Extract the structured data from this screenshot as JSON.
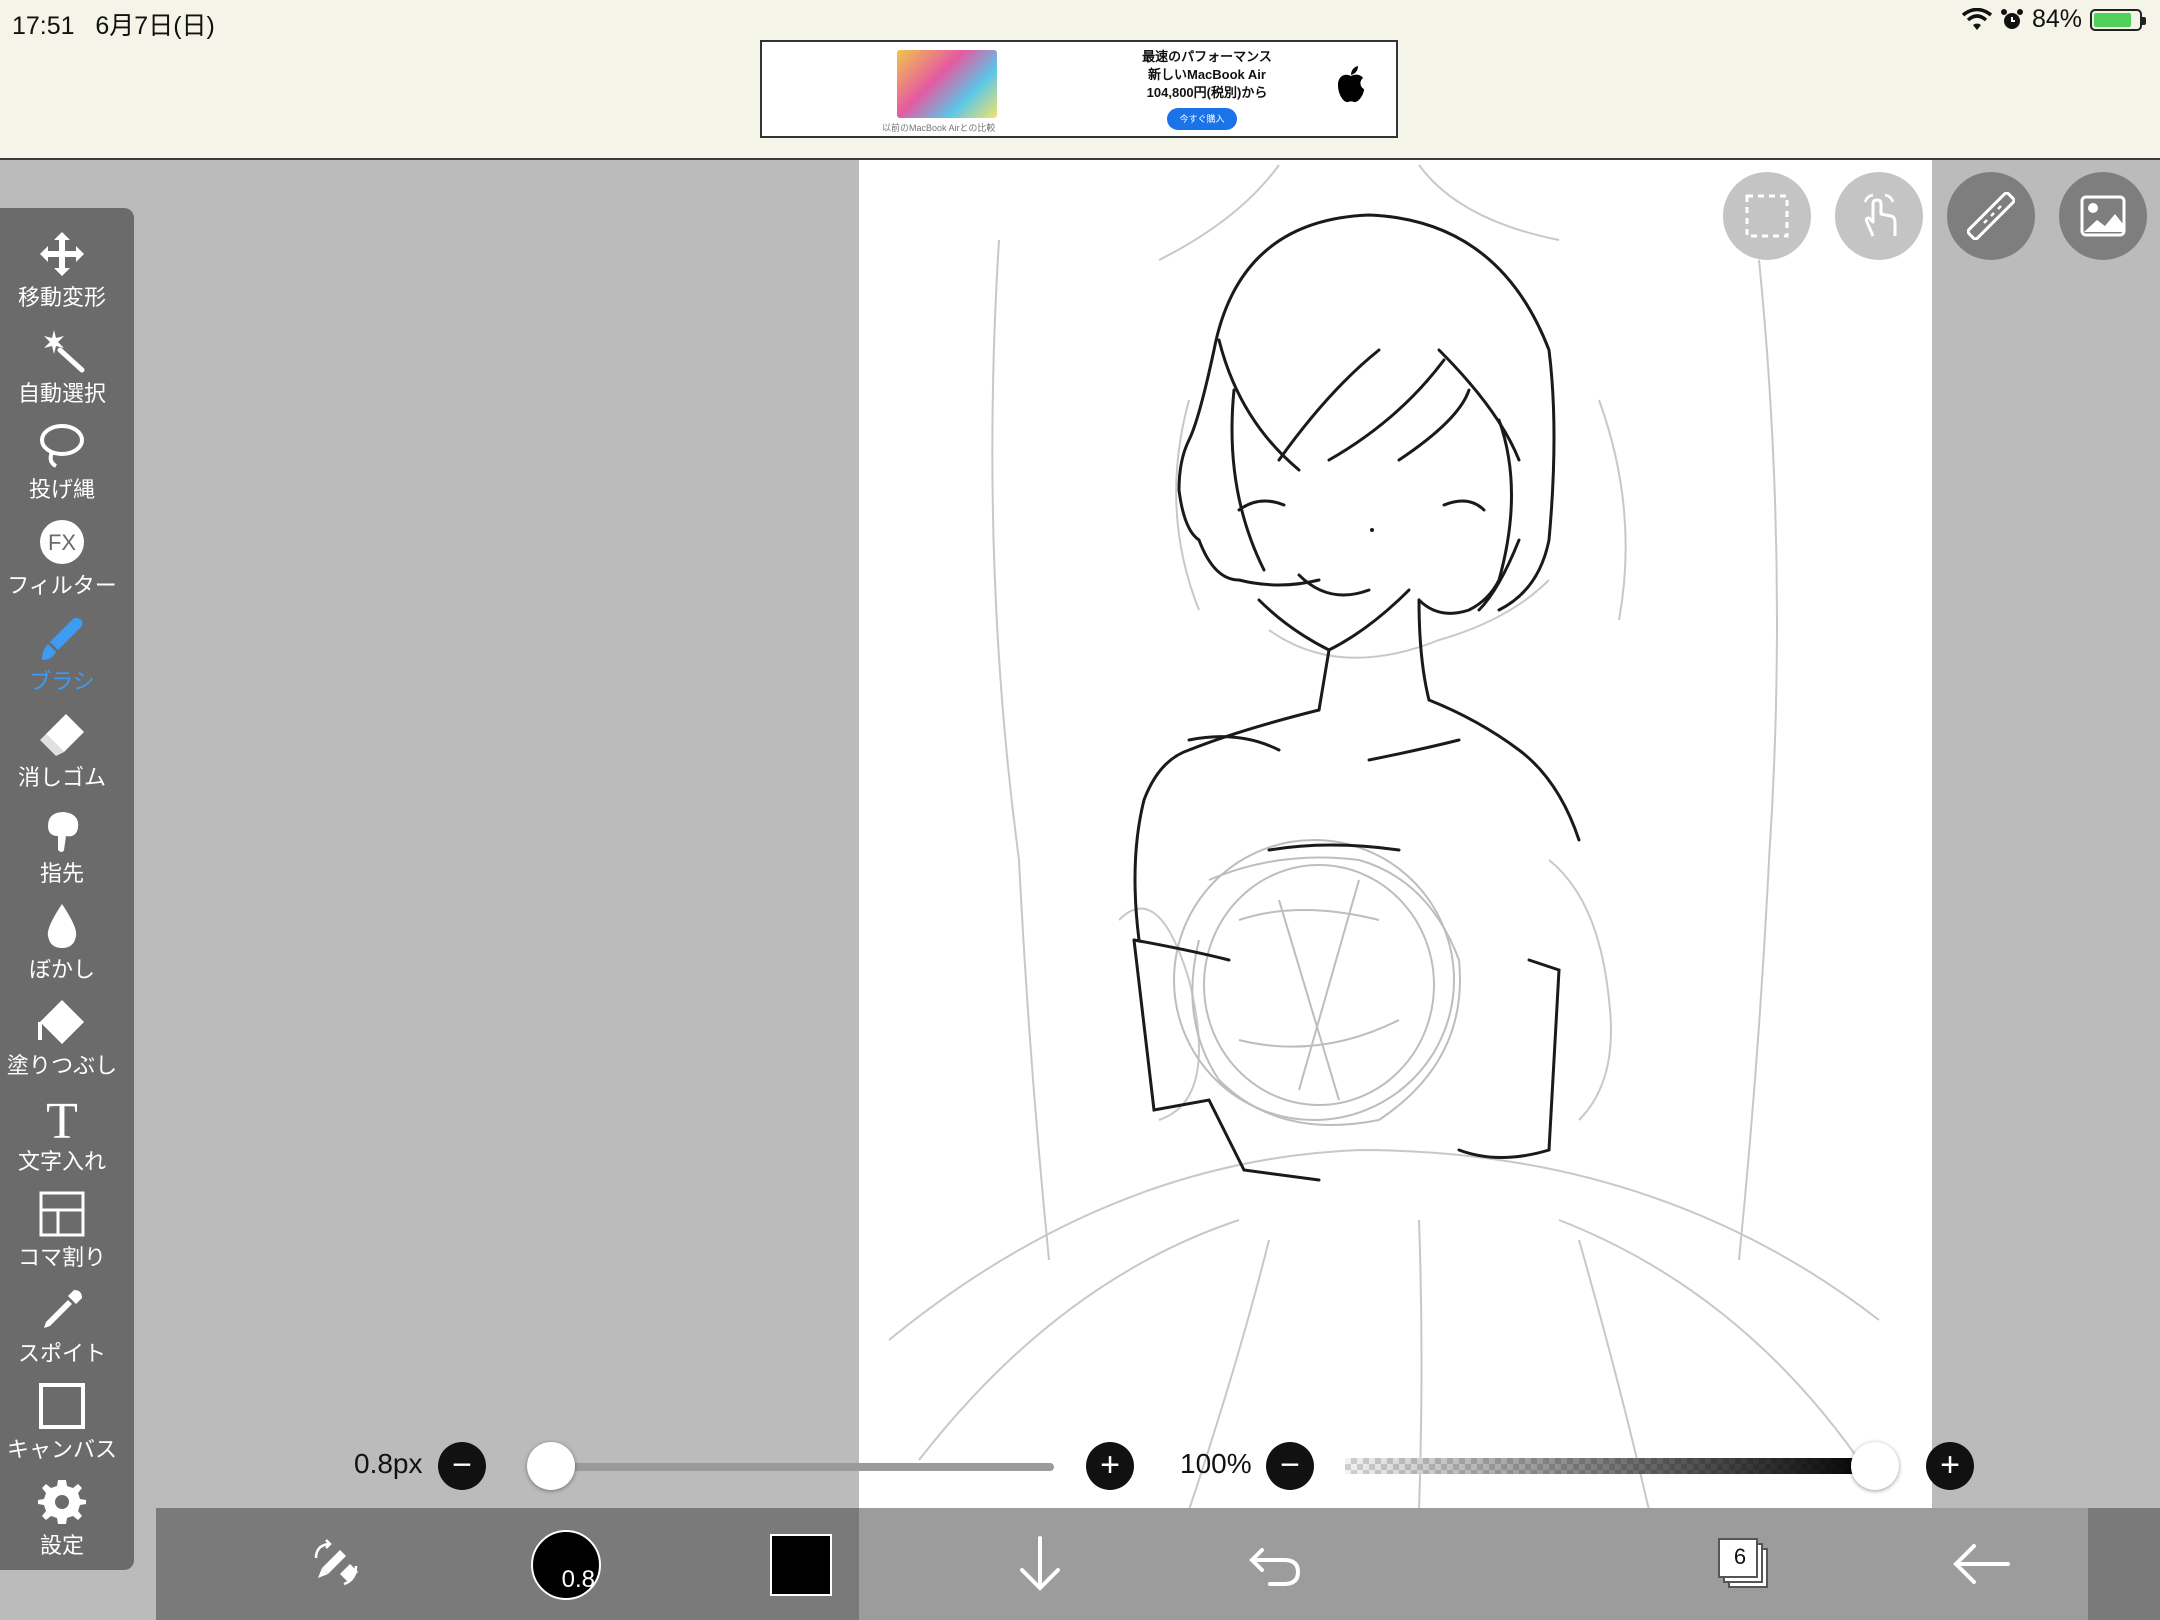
{
  "status_bar": {
    "time": "17:51",
    "date": "6月7日(日)",
    "battery": "84%",
    "battery_level": 0.84
  },
  "ad": {
    "line1": "最速のパフォーマンス",
    "line2": "新しいMacBook Air",
    "line3": "104,800円(税別)から",
    "cta": "今すぐ購入",
    "caption": "以前のMacBook Airとの比較"
  },
  "tools": [
    {
      "label": "移動変形",
      "icon": "move-transform-icon"
    },
    {
      "label": "自動選択",
      "icon": "magic-wand-icon"
    },
    {
      "label": "投げ縄",
      "icon": "lasso-icon"
    },
    {
      "label": "フィルター",
      "icon": "fx-filter-icon"
    },
    {
      "label": "ブラシ",
      "icon": "brush-icon",
      "active": true
    },
    {
      "label": "消しゴム",
      "icon": "eraser-icon"
    },
    {
      "label": "指先",
      "icon": "finger-smudge-icon"
    },
    {
      "label": "ぼかし",
      "icon": "blur-drop-icon"
    },
    {
      "label": "塗りつぶし",
      "icon": "fill-bucket-icon"
    },
    {
      "label": "文字入れ",
      "icon": "text-icon"
    },
    {
      "label": "コマ割り",
      "icon": "panel-divide-icon"
    },
    {
      "label": "スポイト",
      "icon": "eyedropper-icon"
    },
    {
      "label": "キャンバス",
      "icon": "canvas-icon"
    },
    {
      "label": "設定",
      "icon": "gear-icon"
    }
  ],
  "top_buttons": [
    "selection-icon",
    "touch-gesture-icon",
    "ruler-icon",
    "image-icon"
  ],
  "sliders": {
    "brush_size": "0.8px",
    "brush_size_fraction": 0.04,
    "opacity": "100%",
    "opacity_fraction": 1.0,
    "minus": "−",
    "plus": "+"
  },
  "bottom_bar": {
    "brush_size_label": "0.8",
    "color": "#000000",
    "layer_count": "6"
  },
  "colors": {
    "toolbar": "#6b6b6b",
    "active_tool": "#3d9bf2",
    "canvas": "#ffffff",
    "workspace": "#bbbbbb"
  }
}
